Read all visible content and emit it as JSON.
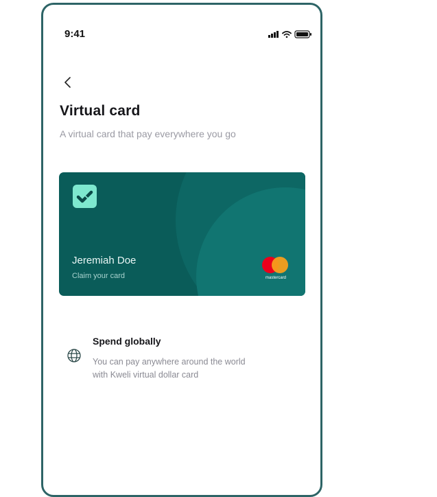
{
  "status_bar": {
    "time": "9:41"
  },
  "header": {
    "title": "Virtual card",
    "subtitle": "A virtual card that pay everywhere you go"
  },
  "card": {
    "holder_name": "Jeremiah Doe",
    "action_label": "Claim your card",
    "brand_label": "mastercard",
    "colors": {
      "background": "#0a5c59",
      "logo_tile": "#7ee8cf"
    }
  },
  "feature": {
    "icon": "globe-icon",
    "title": "Spend globally",
    "description_line1": "You can pay anywhere around the world",
    "description_line2": "with Kweli virtual dollar card"
  },
  "colors": {
    "frame": "#2d6466",
    "accent": "#0a5c59"
  }
}
